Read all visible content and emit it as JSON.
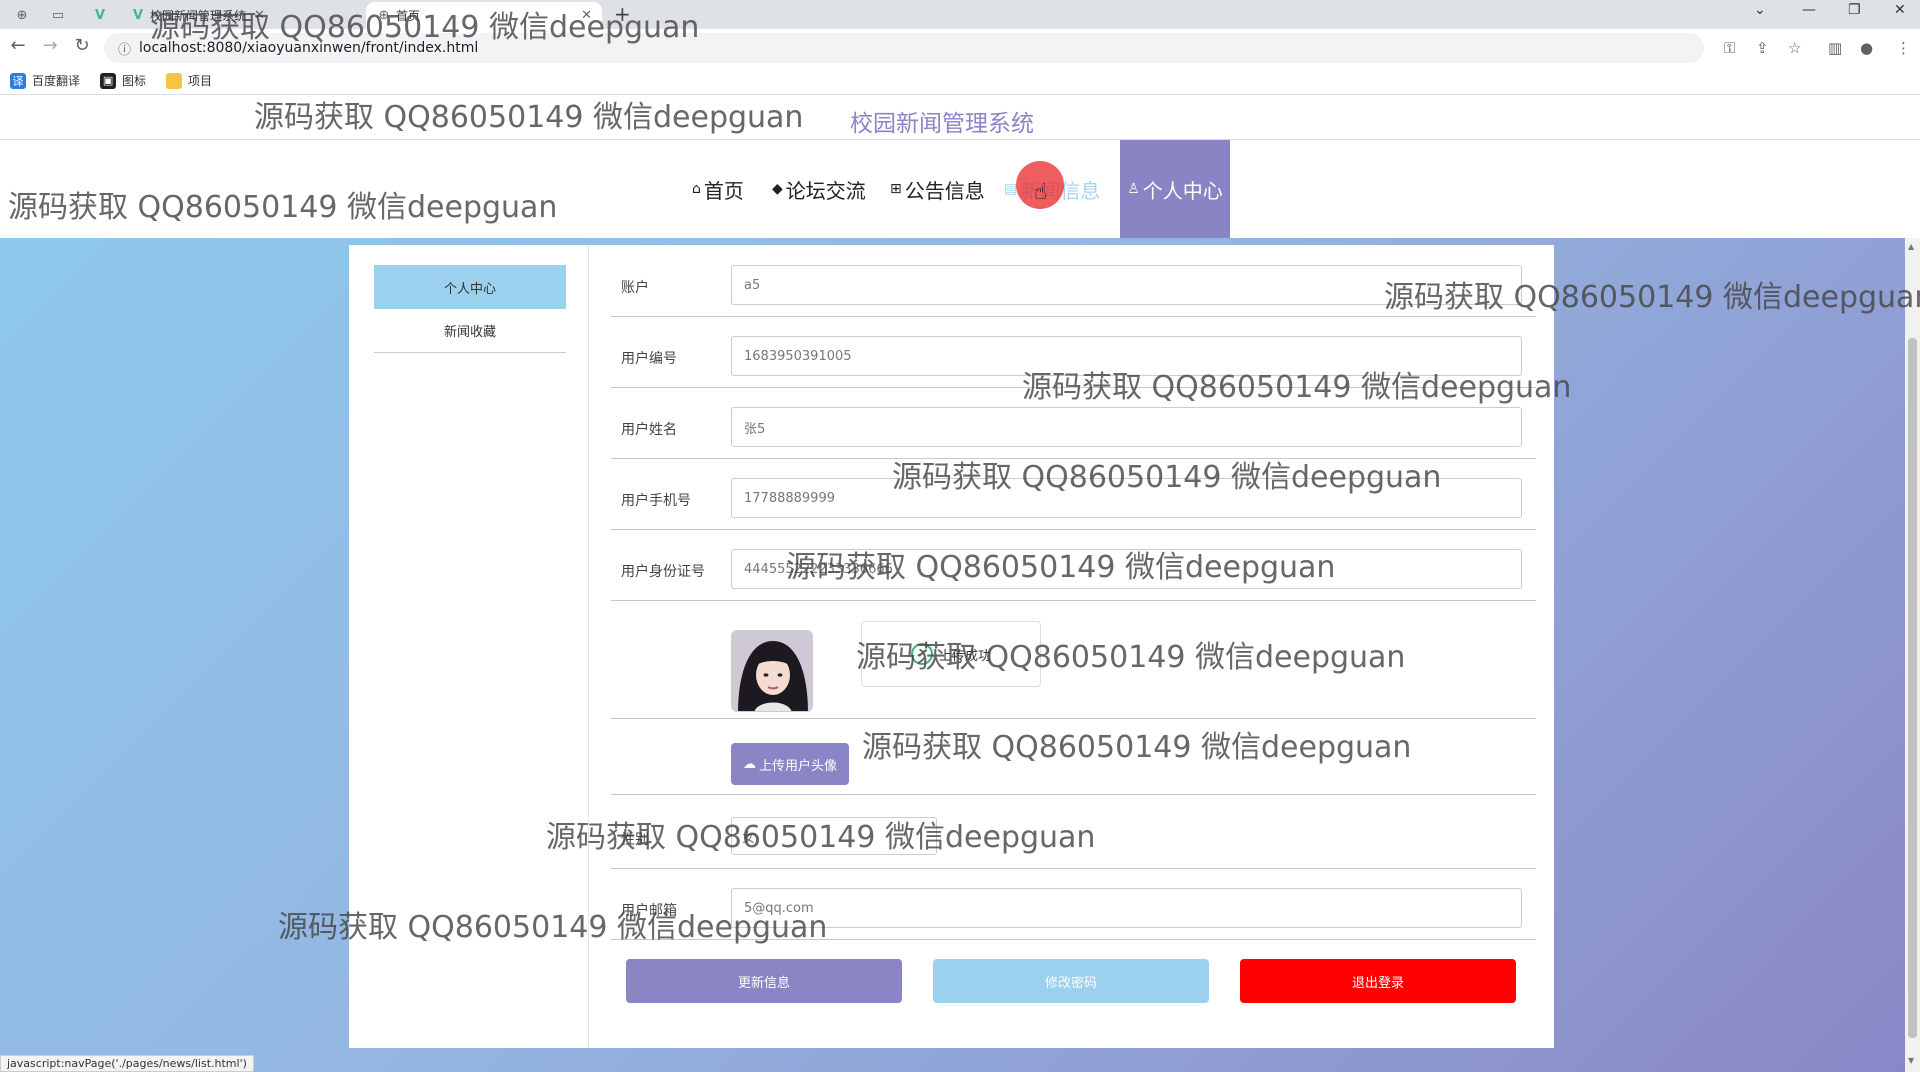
{
  "browser": {
    "tabs": [
      {
        "label": ""
      },
      {
        "label": ""
      },
      {
        "label": ""
      },
      {
        "label": "校园新闻管理系统"
      },
      {
        "label": "首页"
      }
    ],
    "url": "localhost:8080/xiaoyuanxinwen/front/index.html",
    "bookmarks": [
      "百度翻译",
      "图标",
      "项目"
    ],
    "status_text": "javascript:navPage('./pages/news/list.html')"
  },
  "site": {
    "title": "校园新闻管理系统",
    "nav": [
      "首页",
      "论坛交流",
      "公告信息",
      "新闻信息",
      "个人中心"
    ]
  },
  "sidebar": {
    "items": [
      "个人中心",
      "新闻收藏"
    ]
  },
  "form": {
    "account_label": "账户",
    "account_value": "a5",
    "user_no_label": "用户编号",
    "user_no_value": "1683950391005",
    "name_label": "用户姓名",
    "name_value": "张5",
    "phone_label": "用户手机号",
    "phone_value": "17788889999",
    "idcard_label": "用户身份证号",
    "idcard_value": "444555222233336666",
    "upload_success": "上传成功",
    "upload_button": "上传用户头像",
    "sex_label": "性别",
    "sex_value": "女",
    "email_label": "用户邮箱",
    "email_value": "5@qq.com"
  },
  "actions": {
    "update": "更新信息",
    "change_password": "修改密码",
    "logout": "退出登录"
  },
  "colors": {
    "accent": "#8a85c4",
    "light_blue": "#9bd0ee",
    "danger": "#ff0000"
  },
  "watermark": "源码获取 QQ86050149 微信deepguan"
}
